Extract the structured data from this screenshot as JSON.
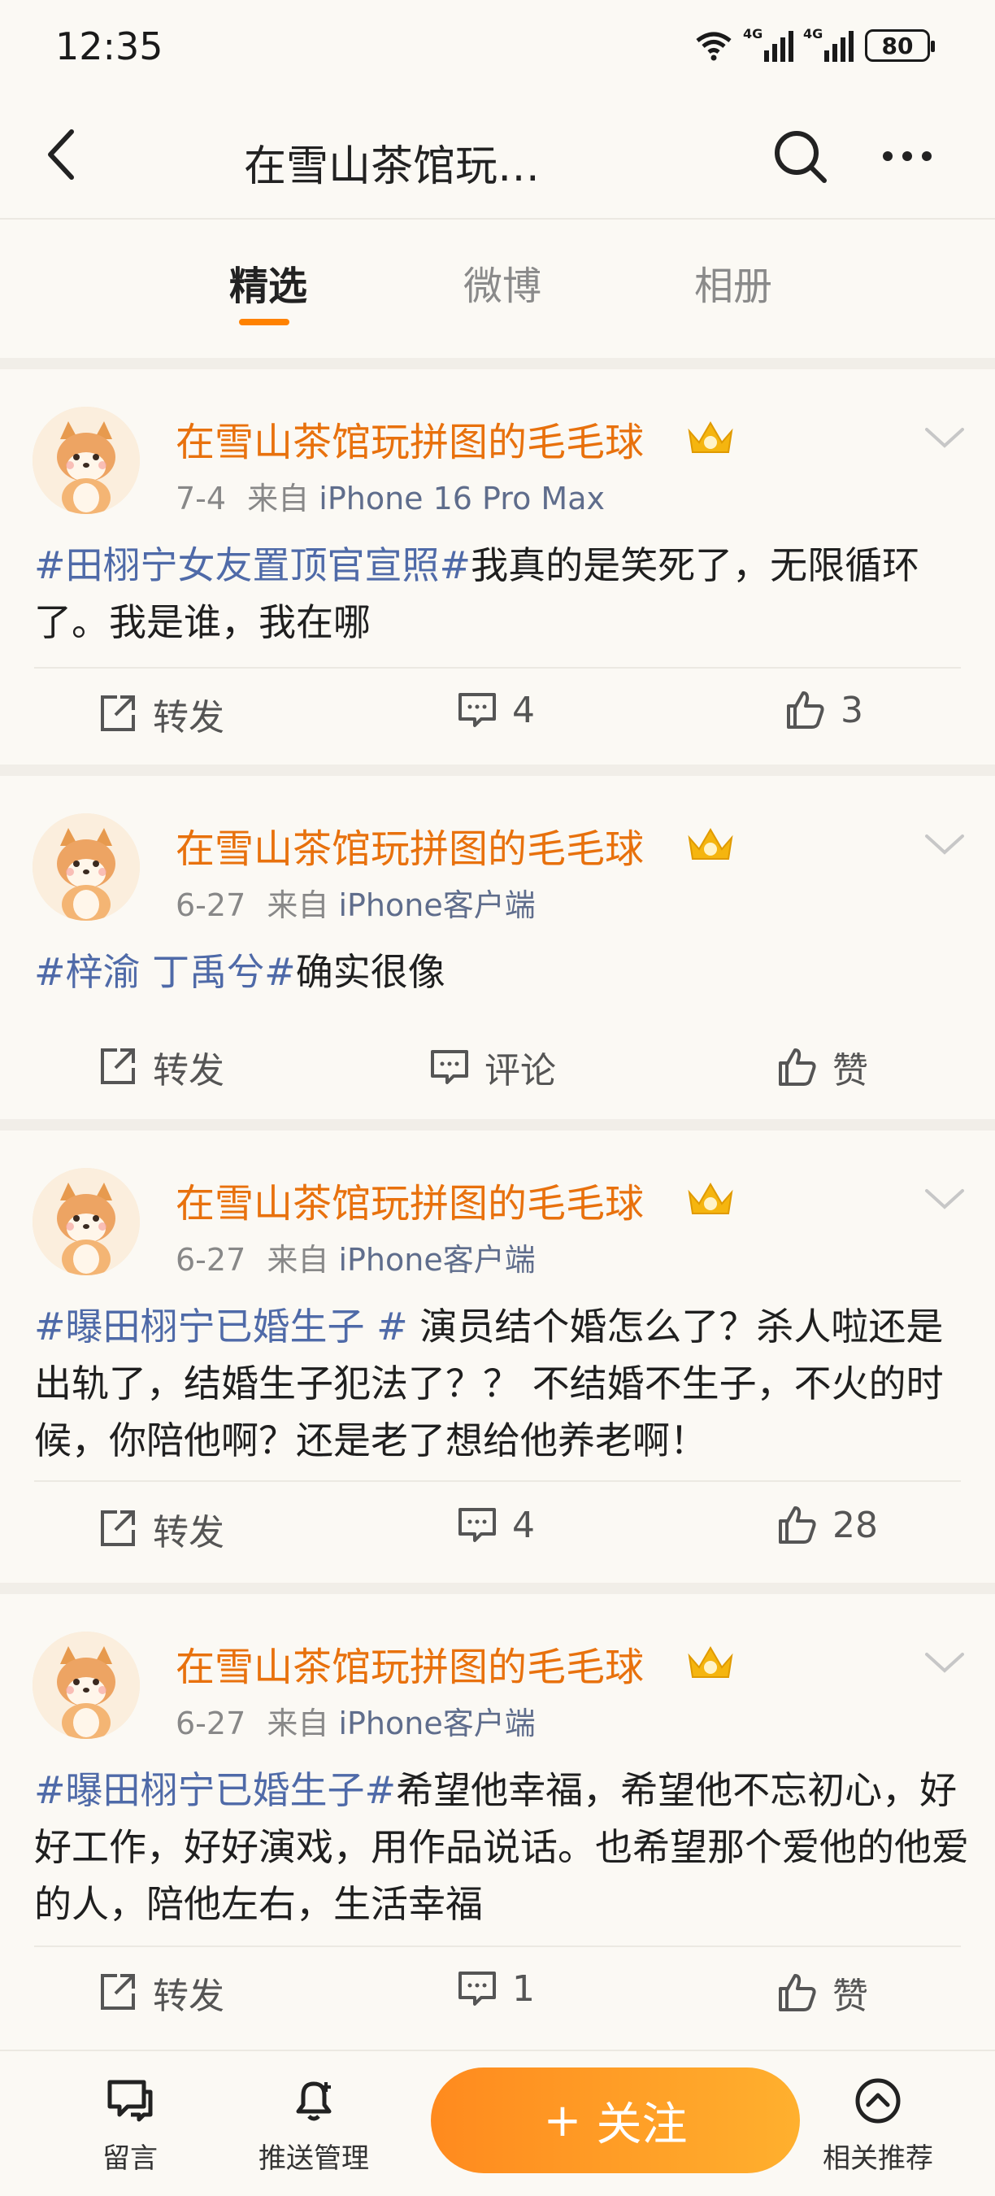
{
  "status_bar": {
    "time": "12:35",
    "signal1": "4G",
    "signal2": "4G",
    "battery": "80"
  },
  "nav": {
    "title": "在雪山茶馆玩…"
  },
  "tabs": [
    {
      "label": "精选",
      "active": true
    },
    {
      "label": "微博",
      "active": false
    },
    {
      "label": "相册",
      "active": false
    }
  ],
  "posts": [
    {
      "username": "在雪山茶馆玩拼图的毛毛球",
      "date": "7-4",
      "source_prefix": "来自",
      "source": "iPhone 16 Pro Max",
      "tag": "#田栩宁女友置顶官宣照#",
      "text": "我真的是笑死了，无限循环了。我是谁，我在哪",
      "repost": "转发",
      "comments": "4",
      "likes": "3"
    },
    {
      "username": "在雪山茶馆玩拼图的毛毛球",
      "date": "6-27",
      "source_prefix": "来自",
      "source": "iPhone客户端",
      "tag": "#梓渝 丁禹兮#",
      "text": "确实很像",
      "repost": "转发",
      "comments": "评论",
      "likes": "赞"
    },
    {
      "username": "在雪山茶馆玩拼图的毛毛球",
      "date": "6-27",
      "source_prefix": "来自",
      "source": "iPhone客户端",
      "tag": "#曝田栩宁已婚生子 #",
      "text": " 演员结个婚怎么了？杀人啦还是出轨了，结婚生子犯法了？？ 不结婚不生子，不火的时候，你陪他啊？还是老了想给他养老啊！",
      "repost": "转发",
      "comments": "4",
      "likes": "28"
    },
    {
      "username": "在雪山茶馆玩拼图的毛毛球",
      "date": "6-27",
      "source_prefix": "来自",
      "source": "iPhone客户端",
      "tag": "#曝田栩宁已婚生子#",
      "text": "希望他幸福，希望他不忘初心，好好工作，好好演戏，用作品说话。也希望那个爱他的他爱的人，陪他左右，生活幸福",
      "repost": "转发",
      "comments": "1",
      "likes": "赞"
    }
  ],
  "bottom_bar": {
    "message": "留言",
    "push_manage": "推送管理",
    "follow": "关注",
    "follow_plus": "+",
    "related": "相关推荐"
  },
  "colors": {
    "accent": "#ff8200",
    "username": "#e8710d",
    "topic": "#4f6aa8"
  }
}
